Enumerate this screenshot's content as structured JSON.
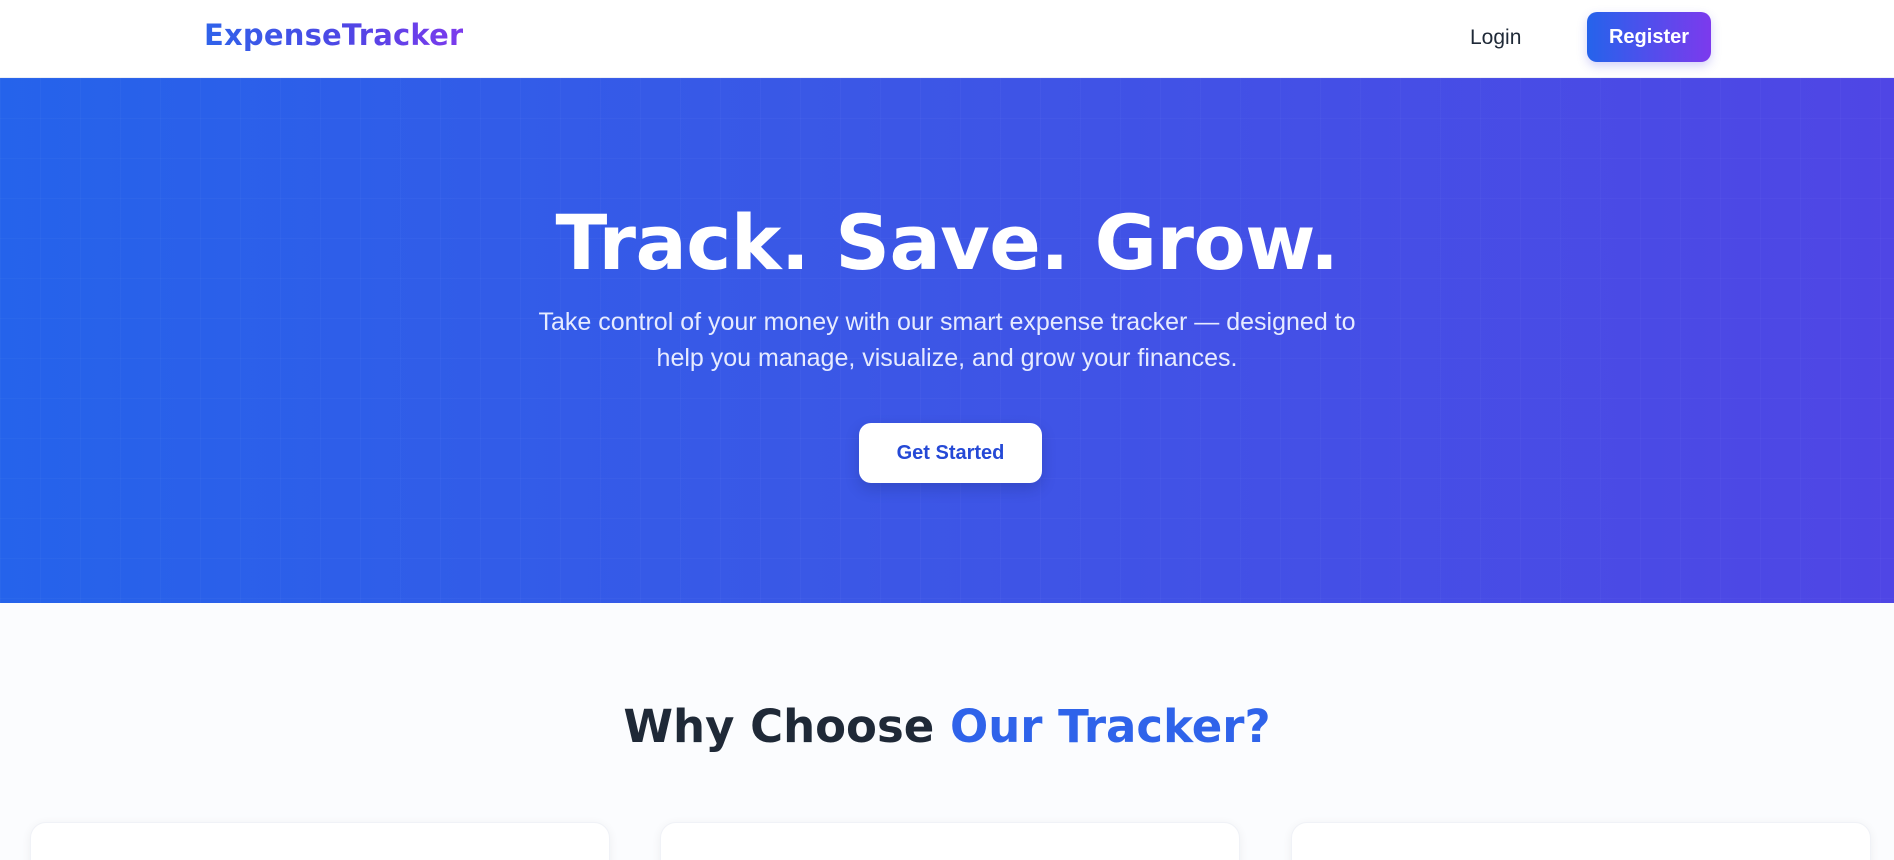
{
  "navbar": {
    "logo": "ExpenseTracker",
    "login_label": "Login",
    "register_label": "Register"
  },
  "hero": {
    "title": "Track. Save. Grow.",
    "subtitle": "Take control of your money with our smart expense tracker — designed to help you manage, visualize, and grow your finances.",
    "cta_label": "Get Started"
  },
  "features": {
    "heading_part1": "Why Choose ",
    "heading_part2": "Our Tracker?"
  },
  "colors": {
    "brand_blue": "#2563eb",
    "brand_purple": "#7c3aed",
    "hero_gradient_start": "#2563eb",
    "hero_gradient_end": "#4f46e5"
  }
}
